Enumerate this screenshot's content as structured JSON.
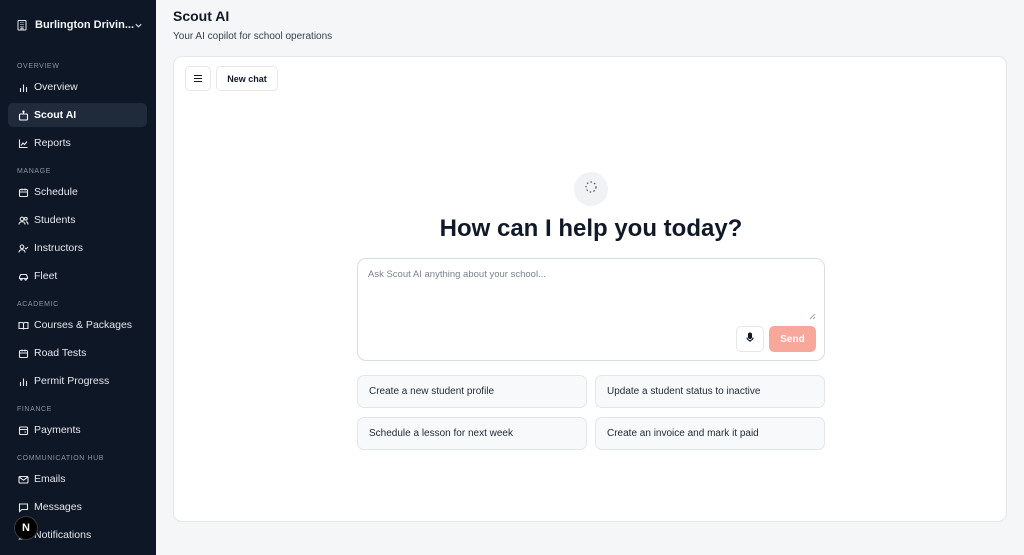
{
  "sidebar": {
    "org_name": "Burlington Drivin...",
    "sections": {
      "overview": "OVERVIEW",
      "manage": "MANAGE",
      "academic": "ACADEMIC",
      "finance": "FINANCE",
      "comm": "COMMUNICATION HUB"
    },
    "items": {
      "overview": "Overview",
      "scout": "Scout AI",
      "reports": "Reports",
      "schedule": "Schedule",
      "students": "Students",
      "instructors": "Instructors",
      "fleet": "Fleet",
      "courses": "Courses & Packages",
      "roadtests": "Road Tests",
      "permit": "Permit Progress",
      "payments": "Payments",
      "emails": "Emails",
      "messages": "Messages",
      "notifications": "Notifications"
    },
    "active": "scout",
    "badge": "N"
  },
  "header": {
    "title": "Scout AI",
    "subtitle": "Your AI copilot for school operations"
  },
  "chat": {
    "new_chat_label": "New chat",
    "hero": "How can I help you today?",
    "input_placeholder": "Ask Scout AI anything about your school...",
    "input_value": "",
    "send_label": "Send",
    "suggestions": [
      "Create a new student profile",
      "Update a student status to inactive",
      "Schedule a lesson for next week",
      "Create an invoice and mark it paid"
    ]
  },
  "colors": {
    "sidebar_bg": "#0e1726",
    "active_bg": "#1f2a3b",
    "send_bg": "#f7a89a"
  },
  "icons": {
    "org": "building-icon",
    "chevron": "chevron-down-icon",
    "menu": "menu-icon",
    "logo": "dotted-circle-icon",
    "mic": "microphone-icon"
  }
}
